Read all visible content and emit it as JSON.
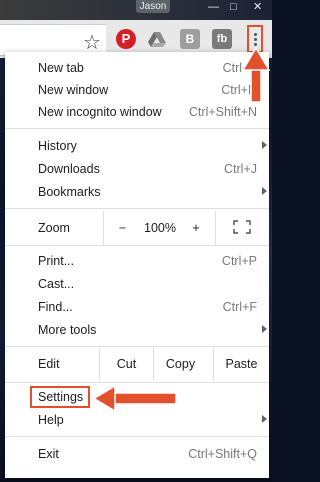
{
  "titlebar": {
    "profile_name": "Jason",
    "min": "—",
    "max": "□",
    "close": "✕"
  },
  "toolbar": {
    "bookmark_icon": "star-icon",
    "extensions": [
      {
        "name": "pinterest-icon",
        "label": "P"
      },
      {
        "name": "drive-icon",
        "label": ""
      },
      {
        "name": "b-extension-icon",
        "label": "B"
      },
      {
        "name": "facebook-extension-icon",
        "label": "fb"
      }
    ],
    "menu_icon": "three-dot-menu-icon"
  },
  "menu": {
    "new_tab": {
      "label": "New tab",
      "shortcut": "Ctrl+T"
    },
    "new_window": {
      "label": "New window",
      "shortcut": "Ctrl+N"
    },
    "incognito": {
      "label": "New incognito window",
      "shortcut": "Ctrl+Shift+N"
    },
    "history": {
      "label": "History"
    },
    "downloads": {
      "label": "Downloads",
      "shortcut": "Ctrl+J"
    },
    "bookmarks": {
      "label": "Bookmarks"
    },
    "zoom": {
      "label": "Zoom",
      "minus": "−",
      "level": "100%",
      "plus": "+"
    },
    "print": {
      "label": "Print...",
      "shortcut": "Ctrl+P"
    },
    "cast": {
      "label": "Cast..."
    },
    "find": {
      "label": "Find...",
      "shortcut": "Ctrl+F"
    },
    "more_tools": {
      "label": "More tools"
    },
    "edit": {
      "label": "Edit",
      "cut": "Cut",
      "copy": "Copy",
      "paste": "Paste"
    },
    "settings": {
      "label": "Settings"
    },
    "help": {
      "label": "Help"
    },
    "exit": {
      "label": "Exit",
      "shortcut": "Ctrl+Shift+Q"
    }
  },
  "colors": {
    "highlight": "#e2512b",
    "menu_bg": "#ffffff",
    "separator": "#e0e0e0"
  }
}
